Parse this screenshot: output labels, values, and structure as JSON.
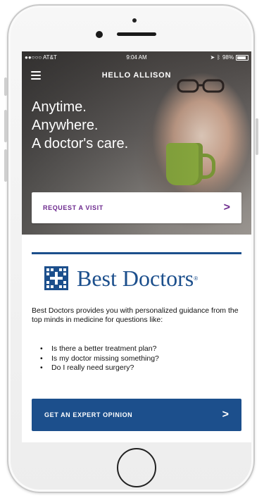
{
  "status_bar": {
    "carrier": "●●○○○ AT&T",
    "time": "9:04 AM",
    "battery": "98%"
  },
  "header": {
    "greeting": "HELLO ALLISON"
  },
  "hero": {
    "lines": [
      "Anytime.",
      "Anywhere.",
      "A doctor's care."
    ]
  },
  "visit_card": {
    "label": "REQUEST A VISIT",
    "chevron": ">"
  },
  "brand": {
    "name": "Best Doctors",
    "trademark": "®"
  },
  "description": "Best Doctors provides you with personalized guidance from the top minds in medicine for questions like:",
  "questions": [
    "Is there a better treatment plan?",
    "Is my doctor missing something?",
    "Do I really need surgery?"
  ],
  "expert_button": {
    "label": "GET AN EXPERT OPINION",
    "chevron": ">"
  },
  "colors": {
    "brand_blue": "#1c4f8c",
    "accent_purple": "#6d2a8e"
  }
}
